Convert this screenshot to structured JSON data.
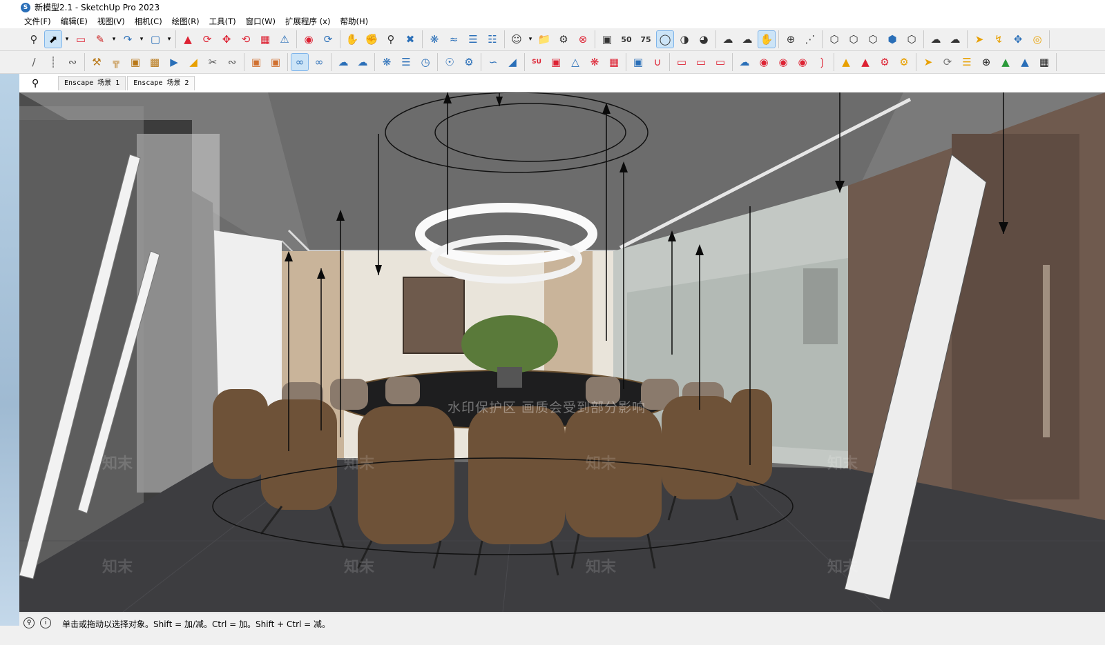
{
  "window": {
    "title": "新模型2.1 - SketchUp Pro 2023"
  },
  "menu": {
    "items": [
      "文件(F)",
      "编辑(E)",
      "视图(V)",
      "相机(C)",
      "绘图(R)",
      "工具(T)",
      "窗口(W)",
      "扩展程序 (x)",
      "帮助(H)"
    ]
  },
  "toolbar_icons_row1": [
    "search-icon",
    "select-arrow-icon",
    "eraser-icon",
    "pencil-line-icon",
    "arc-icon",
    "shape-icon",
    "push-pull-icon",
    "rotate-icon",
    "move-icon",
    "refresh-icon",
    "scale-icon",
    "warning-tape-icon",
    "paint-icon",
    "orbit-icon",
    "pan-icon",
    "zoom-icon",
    "zoom-extents-icon",
    "component-icon",
    "layers-icon",
    "cloud-upload-icon",
    "user-icon",
    "folder-icon",
    "gear-icon",
    "stop-icon",
    "chip-icon",
    "badge-50-icon",
    "badge-75-icon",
    "drop-icon",
    "half-circle-icon",
    "stripe-circle-icon",
    "cloud-icon",
    "download-cloud-icon",
    "hand-icon",
    "dot-icon",
    "dashed-line-icon",
    "cube-icon",
    "pin-icon",
    "lightning-icon",
    "target-icon"
  ],
  "toolbar_icons_row2": [
    "knife-icon",
    "ruler-icon",
    "snake-icon",
    "hammer-icon",
    "table-icon",
    "box-icon",
    "chair-icon",
    "truck-icon",
    "scissors-icon",
    "fish-icon",
    "frame-icon",
    "link-icon",
    "curve-icon",
    "spiral-icon",
    "cloud-edit-icon",
    "loop-icon",
    "atom-icon",
    "bars-icon",
    "clock-icon",
    "compass-icon",
    "settings-icon",
    "stairs-icon",
    "triangle-icon",
    "su-app-icon",
    "cube-red-icon",
    "wire-icon",
    "network-icon",
    "stack-icon",
    "pipe-icon",
    "magnet-icon",
    "rails-icon",
    "bend-icon",
    "cloud-red-icon",
    "bug-icon",
    "globe-icon",
    "rss-icon",
    "layers-orange-icon",
    "fire-icon",
    "wrench-icon",
    "sync-icon",
    "bars-orange-icon",
    "plus-circle-icon",
    "tree-icon",
    "mountain-icon",
    "checker-icon"
  ],
  "scene_bar": {
    "tabs": [
      "Enscape 场景 1",
      "Enscape 场景 2"
    ]
  },
  "watermark": {
    "text": "水印保护区 画质会受到部分影响",
    "logo": "知末"
  },
  "status": {
    "hint": "单击或拖动以选择对象。Shift = 加/减。Ctrl = 加。Shift + Ctrl = 减。"
  },
  "colors": {
    "accent": "#2a6fb8",
    "active_tool": "#cce4f7"
  }
}
